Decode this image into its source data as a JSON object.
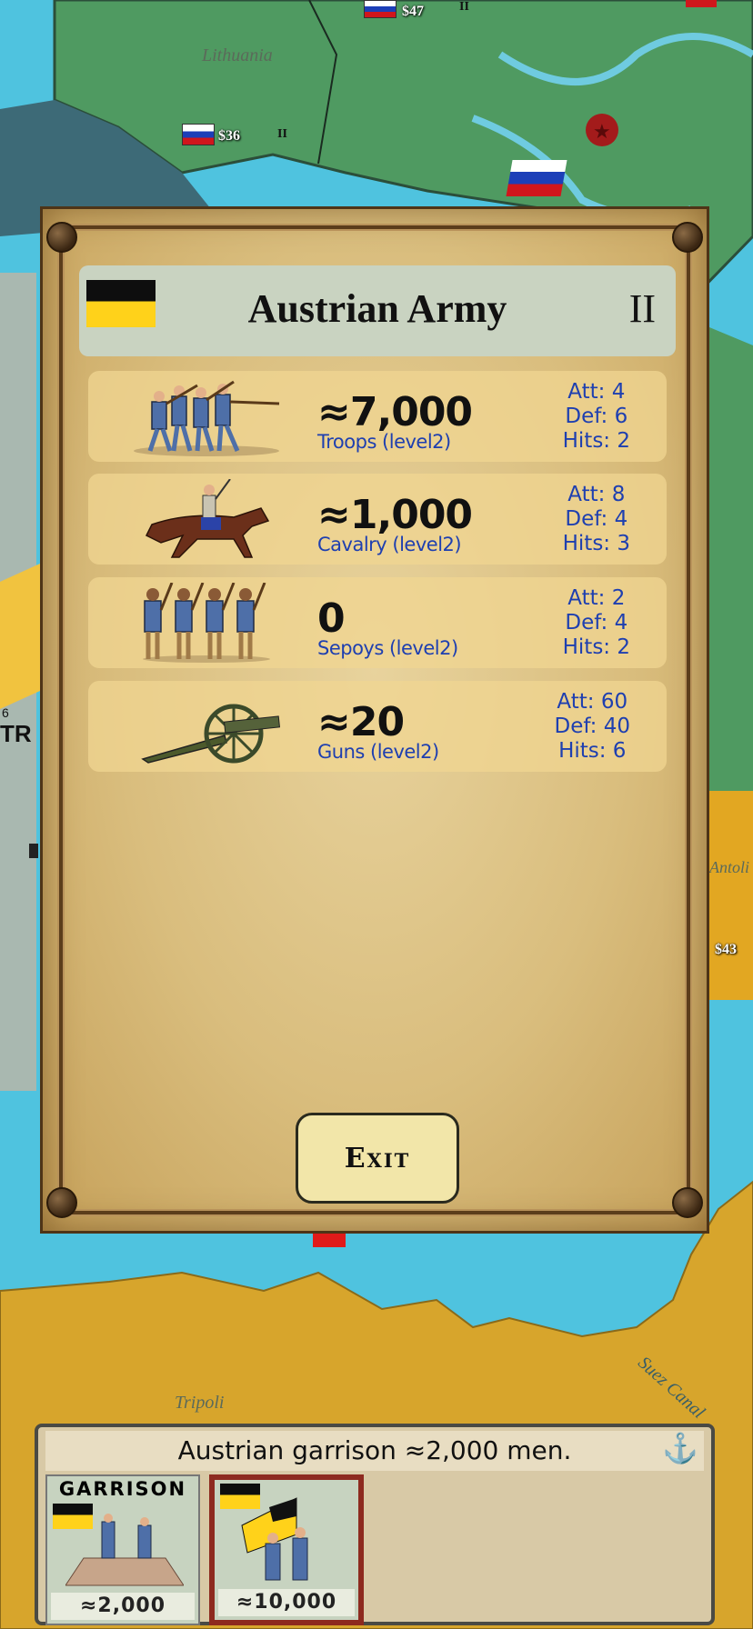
{
  "map": {
    "labels": {
      "lithuania": "Lithuania",
      "antolia": "Antoli",
      "tripoli": "Tripoli",
      "suez": "Suez Canal"
    },
    "money": {
      "lithuania": "$36",
      "top": "$47",
      "antolia": "$43"
    },
    "level_marks": {
      "lithuania": "II",
      "top": "II"
    },
    "edge_text": {
      "tr": "TR",
      "six": "6"
    }
  },
  "army_panel": {
    "title": "Austrian Army",
    "level": "II",
    "units": [
      {
        "count": "≈7,000",
        "name": "Troops (level2)",
        "att": "Att: 4",
        "def": "Def: 6",
        "hits": "Hits: 2"
      },
      {
        "count": "≈1,000",
        "name": "Cavalry (level2)",
        "att": "Att: 8",
        "def": "Def: 4",
        "hits": "Hits: 3"
      },
      {
        "count": "0",
        "name": "Sepoys (level2)",
        "att": "Att: 2",
        "def": "Def: 4",
        "hits": "Hits: 2"
      },
      {
        "count": "≈20",
        "name": "Guns (level2)",
        "att": "Att: 60",
        "def": "Def: 40",
        "hits": "Hits: 6"
      }
    ],
    "exit_label": "Exit"
  },
  "garrison": {
    "header": "Austrian garrison ≈2,000 men.",
    "cards": [
      {
        "label": "Garrison",
        "count": "≈2,000"
      },
      {
        "label": "",
        "count": "≈10,000"
      }
    ]
  },
  "colors": {
    "austria_black": "#0e0e0e",
    "austria_yellow": "#ffd21a",
    "stat_blue": "#1e3fb0"
  },
  "icons": {
    "anchor": "anchor-icon",
    "star": "red-star-icon"
  }
}
